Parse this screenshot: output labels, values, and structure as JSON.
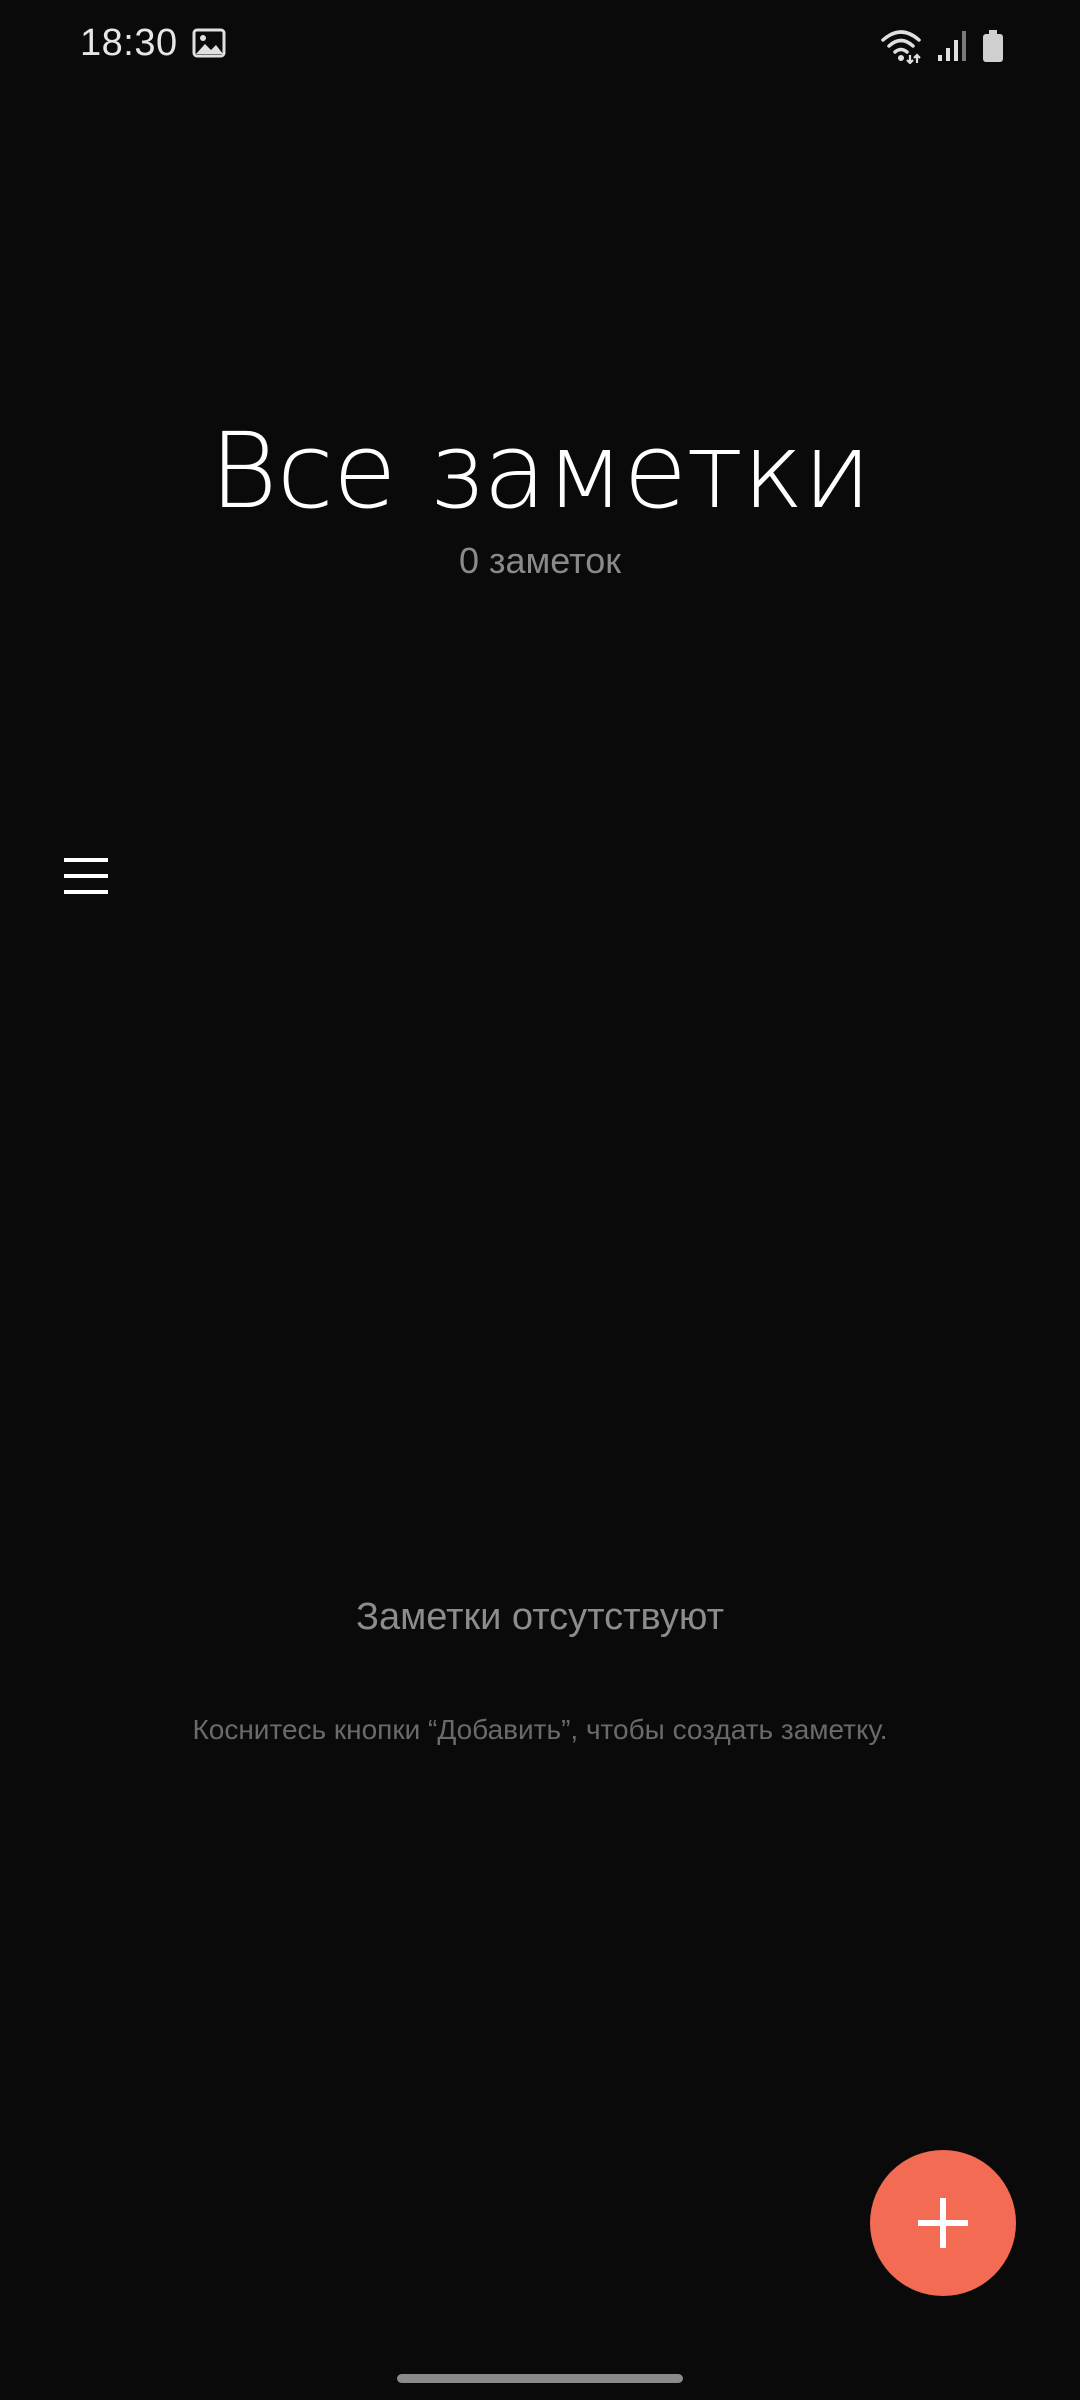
{
  "status_bar": {
    "time": "18:30",
    "icons": [
      "gallery-icon",
      "wifi-icon",
      "signal-icon",
      "battery-icon"
    ]
  },
  "header": {
    "title": "Все заметки",
    "subtitle": "0 заметок"
  },
  "menu": {
    "icon": "hamburger-menu-icon"
  },
  "empty_state": {
    "title": "Заметки отсутствуют",
    "hint": "Коснитесь кнопки “Добавить”, чтобы создать заметку."
  },
  "fab": {
    "icon": "plus-icon",
    "color": "#f26b52"
  },
  "colors": {
    "background": "#0a0a0a",
    "accent": "#f26b52"
  }
}
